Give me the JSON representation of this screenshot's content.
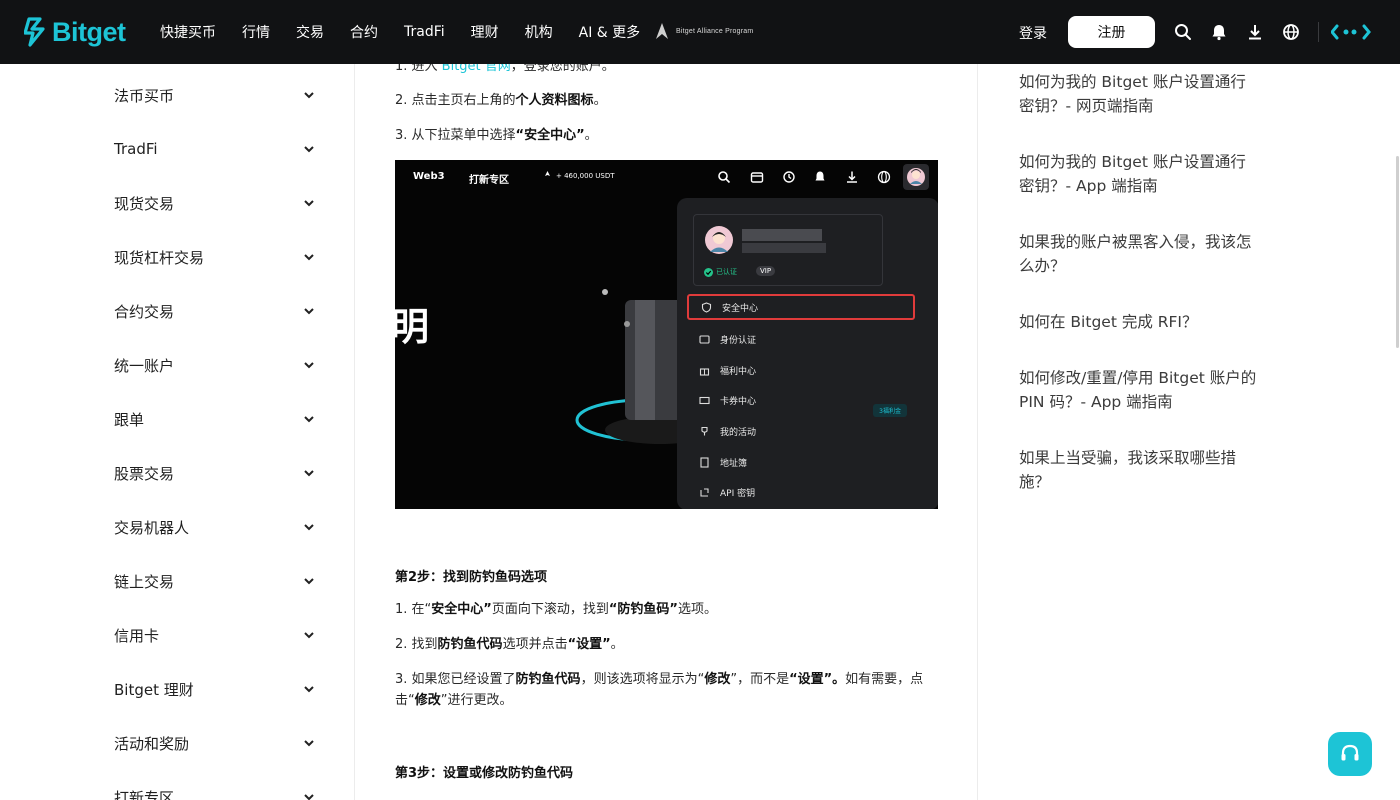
{
  "header": {
    "logo_text": "Bitget",
    "nav": [
      "快捷买币",
      "行情",
      "交易",
      "合约",
      "TradFi",
      "理财",
      "机构",
      "AI & 更多"
    ],
    "alliance_text": "Bitget Alliance Program",
    "login_label": "登录",
    "register_label": "注册",
    "icons": [
      "search-icon",
      "bell-icon",
      "download-icon",
      "globe-icon",
      "brand-dots-icon"
    ]
  },
  "sidebar": {
    "items": [
      {
        "label": "法币买币"
      },
      {
        "label": "TradFi"
      },
      {
        "label": "现货交易"
      },
      {
        "label": "现货杠杆交易"
      },
      {
        "label": "合约交易"
      },
      {
        "label": "统一账户"
      },
      {
        "label": "跟单"
      },
      {
        "label": "股票交易"
      },
      {
        "label": "交易机器人"
      },
      {
        "label": "链上交易"
      },
      {
        "label": "信用卡"
      },
      {
        "label": "Bitget 理财"
      },
      {
        "label": "活动和奖励"
      },
      {
        "label": "打新专区"
      }
    ]
  },
  "article": {
    "step1": {
      "l1_pre": "1. 进入 ",
      "l1_link": "Bitget 官网",
      "l1_post": "，登录您的账户。",
      "l2_pre": "2. 点击主页右上角的",
      "l2_bold": "个人资料图标",
      "l2_post": "。",
      "l3_pre": "3. 从下拉菜单中选择",
      "l3_bold": "“安全中心”",
      "l3_post": "。"
    },
    "screenshot": {
      "nav_web3": "Web3",
      "nav_launch": "打新专区",
      "usdt": "+ 460,000 USDT",
      "verified": "已认证",
      "vip": "VIP",
      "menu_items": [
        "安全中心",
        "身份认证",
        "福利中心",
        "卡券中心",
        "我的活动",
        "地址簿",
        "API 密钥"
      ],
      "bonus_tag": "3福利金",
      "big_char": "明"
    },
    "step2": {
      "heading": "第2步：找到防钓鱼码选项",
      "l1_pre": "1. 在“",
      "l1_b1": "安全中心”",
      "l1_mid": "页面向下滚动，找到",
      "l1_b2": "“防钓鱼码”",
      "l1_post": "选项。",
      "l2_pre": "2. 找到",
      "l2_b1": "防钓鱼代码",
      "l2_mid": "选项并点击",
      "l2_b2": "“设置”",
      "l2_post": "。",
      "l3_pre": "3. 如果您已经设置了",
      "l3_b1": "防钓鱼代码",
      "l3_mid": "，则该选项将显示为“",
      "l3_b2": "修改",
      "l3_mid2": "”，而不是",
      "l3_b3": "“设置”。",
      "l3_mid3": "如有需要，点击“",
      "l3_b4": "修改",
      "l3_post": "”进行更改。"
    },
    "step3": {
      "heading": "第3步：设置或修改防钓鱼代码"
    }
  },
  "related": [
    "如何为我的 Bitget 账户设置通行密钥？- 网页端指南",
    "如何为我的 Bitget 账户设置通行密钥？- App 端指南",
    "如果我的账户被黑客入侵，我该怎么办？",
    "如何在 Bitget 完成 RFI？",
    "如何修改/重置/停用 Bitget 账户的 PIN 码？- App 端指南",
    "如果上当受骗，我该采取哪些措施？"
  ],
  "colors": {
    "accent": "#1dc4d6",
    "topbar": "#111214",
    "highlight": "#e03b3b"
  }
}
